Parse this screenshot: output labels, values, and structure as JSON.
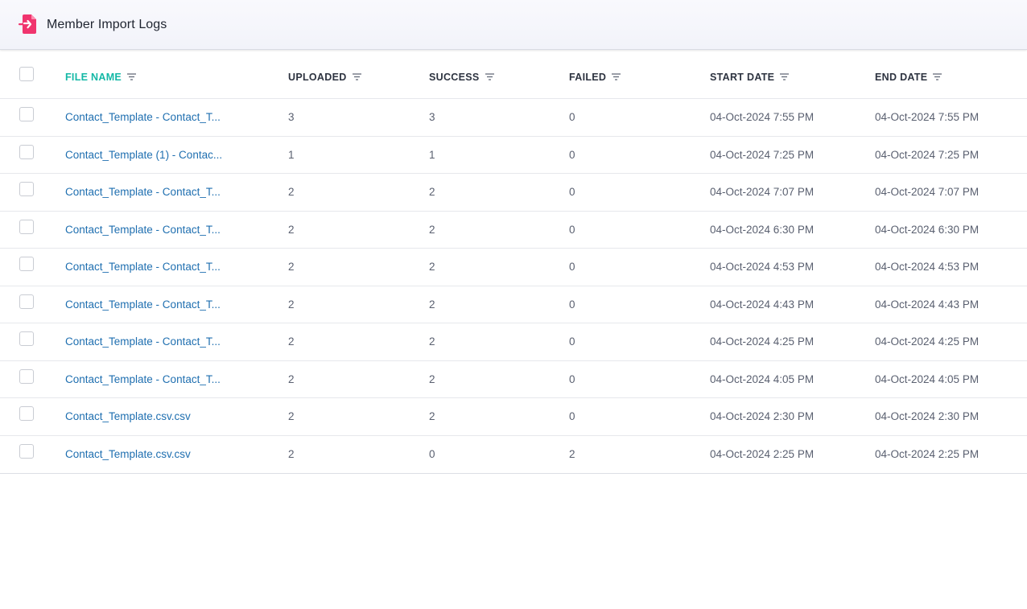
{
  "header": {
    "title": "Member Import Logs",
    "icon": "file-import-icon",
    "icon_color": "#f0346e"
  },
  "columns": {
    "file_name": "FILE NAME",
    "uploaded": "UPLOADED",
    "success": "SUCCESS",
    "failed": "FAILED",
    "start_date": "START DATE",
    "end_date": "END DATE"
  },
  "colors": {
    "active_sort": "#14b8a6",
    "link": "#1f6fb0"
  },
  "rows": [
    {
      "file": "Contact_Template - Contact_T...",
      "uploaded": "3",
      "success": "3",
      "failed": "0",
      "start": "04-Oct-2024 7:55 PM",
      "end": "04-Oct-2024 7:55 PM"
    },
    {
      "file": "Contact_Template (1) - Contac...",
      "uploaded": "1",
      "success": "1",
      "failed": "0",
      "start": "04-Oct-2024 7:25 PM",
      "end": "04-Oct-2024 7:25 PM"
    },
    {
      "file": "Contact_Template - Contact_T...",
      "uploaded": "2",
      "success": "2",
      "failed": "0",
      "start": "04-Oct-2024 7:07 PM",
      "end": "04-Oct-2024 7:07 PM"
    },
    {
      "file": "Contact_Template - Contact_T...",
      "uploaded": "2",
      "success": "2",
      "failed": "0",
      "start": "04-Oct-2024 6:30 PM",
      "end": "04-Oct-2024 6:30 PM"
    },
    {
      "file": "Contact_Template - Contact_T...",
      "uploaded": "2",
      "success": "2",
      "failed": "0",
      "start": "04-Oct-2024 4:53 PM",
      "end": "04-Oct-2024 4:53 PM"
    },
    {
      "file": "Contact_Template - Contact_T...",
      "uploaded": "2",
      "success": "2",
      "failed": "0",
      "start": "04-Oct-2024 4:43 PM",
      "end": "04-Oct-2024 4:43 PM"
    },
    {
      "file": "Contact_Template - Contact_T...",
      "uploaded": "2",
      "success": "2",
      "failed": "0",
      "start": "04-Oct-2024 4:25 PM",
      "end": "04-Oct-2024 4:25 PM"
    },
    {
      "file": "Contact_Template - Contact_T...",
      "uploaded": "2",
      "success": "2",
      "failed": "0",
      "start": "04-Oct-2024 4:05 PM",
      "end": "04-Oct-2024 4:05 PM"
    },
    {
      "file": "Contact_Template.csv.csv",
      "uploaded": "2",
      "success": "2",
      "failed": "0",
      "start": "04-Oct-2024 2:30 PM",
      "end": "04-Oct-2024 2:30 PM"
    },
    {
      "file": "Contact_Template.csv.csv",
      "uploaded": "2",
      "success": "0",
      "failed": "2",
      "start": "04-Oct-2024 2:25 PM",
      "end": "04-Oct-2024 2:25 PM"
    }
  ]
}
